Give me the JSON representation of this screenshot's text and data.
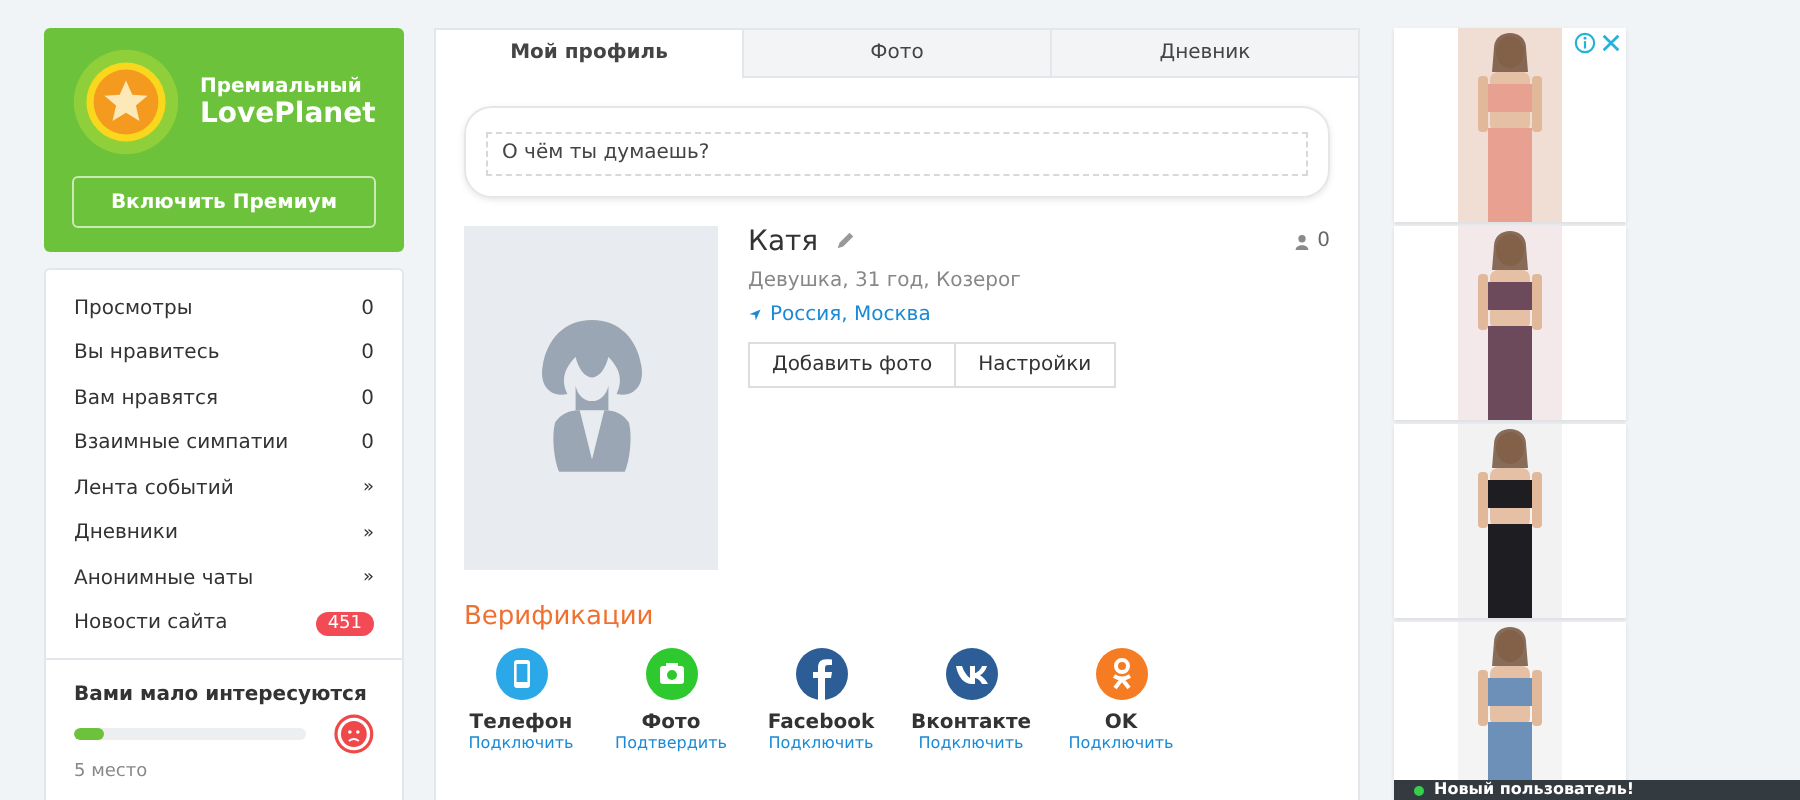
{
  "premium": {
    "title": "Премиальный",
    "brand": "LovePlanet",
    "button": "Включить Премиум"
  },
  "stats": [
    {
      "label": "Просмотры",
      "value": "0",
      "kind": "count"
    },
    {
      "label": "Вы нравитесь",
      "value": "0",
      "kind": "count"
    },
    {
      "label": "Вам нравятся",
      "value": "0",
      "kind": "count"
    },
    {
      "label": "Взаимные симпатии",
      "value": "0",
      "kind": "count"
    },
    {
      "label": "Лента событий",
      "value": "»",
      "kind": "link"
    },
    {
      "label": "Дневники",
      "value": "»",
      "kind": "link"
    },
    {
      "label": "Анонимные чаты",
      "value": "»",
      "kind": "link"
    },
    {
      "label": "Новости сайта",
      "value": "451",
      "kind": "badge"
    }
  ],
  "rating": {
    "title": "Вами мало интересуются",
    "level": 0.13,
    "rank": "5 место"
  },
  "tabs": [
    {
      "label": "Мой профиль",
      "selected": true
    },
    {
      "label": "Фото",
      "selected": false
    },
    {
      "label": "Дневник",
      "selected": false
    }
  ],
  "status": {
    "placeholder": "О чём ты думаешь?"
  },
  "profile": {
    "name": "Катя",
    "details": "Девушка, 31 год, Козерог",
    "location": "Россия, Москва",
    "followers": "0",
    "buttons": [
      "Добавить фото",
      "Настройки"
    ]
  },
  "verifications": {
    "title": "Верификации",
    "items": [
      {
        "kind": "phone",
        "name": "Телефон",
        "action": "Подключить",
        "color": "#2aa8e8"
      },
      {
        "kind": "camera",
        "name": "Фото",
        "action": "Подтвердить",
        "color": "#2ec92e"
      },
      {
        "kind": "facebook",
        "name": "Facebook",
        "action": "Подключить",
        "color": "#2d5d96"
      },
      {
        "kind": "vk",
        "name": "Вконтакте",
        "action": "Подключить",
        "color": "#2d5d96"
      },
      {
        "kind": "ok",
        "name": "OK",
        "action": "Подключить",
        "color": "#f57c22"
      }
    ]
  },
  "notification": {
    "text": "Новый пользователь!"
  }
}
